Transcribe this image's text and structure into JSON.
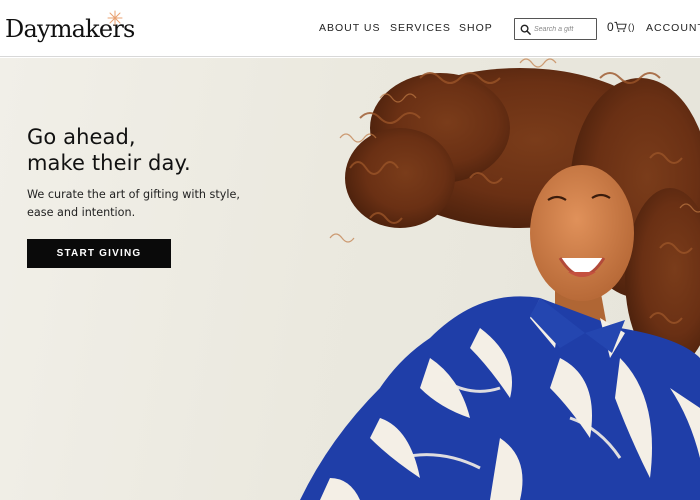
{
  "brand": {
    "name": "Daymakers",
    "accent": "#e8a070"
  },
  "nav": {
    "items": [
      {
        "label": "ABOUT US"
      },
      {
        "label": "SERVICES"
      },
      {
        "label": "SHOP"
      }
    ],
    "account_label": "ACCOUNT"
  },
  "search": {
    "placeholder": "Search a gift",
    "icon": "search-icon"
  },
  "cart": {
    "count": "0",
    "count_display": "()",
    "icon": "cart-icon"
  },
  "hero": {
    "title_line1": "Go ahead,",
    "title_line2": "make their day.",
    "subtitle_line1": "We curate the art of gifting with style,",
    "subtitle_line2": "ease and intention.",
    "cta_label": "START GIVING",
    "cta_color": "#0a0a0a",
    "background": "#ebe9df"
  }
}
